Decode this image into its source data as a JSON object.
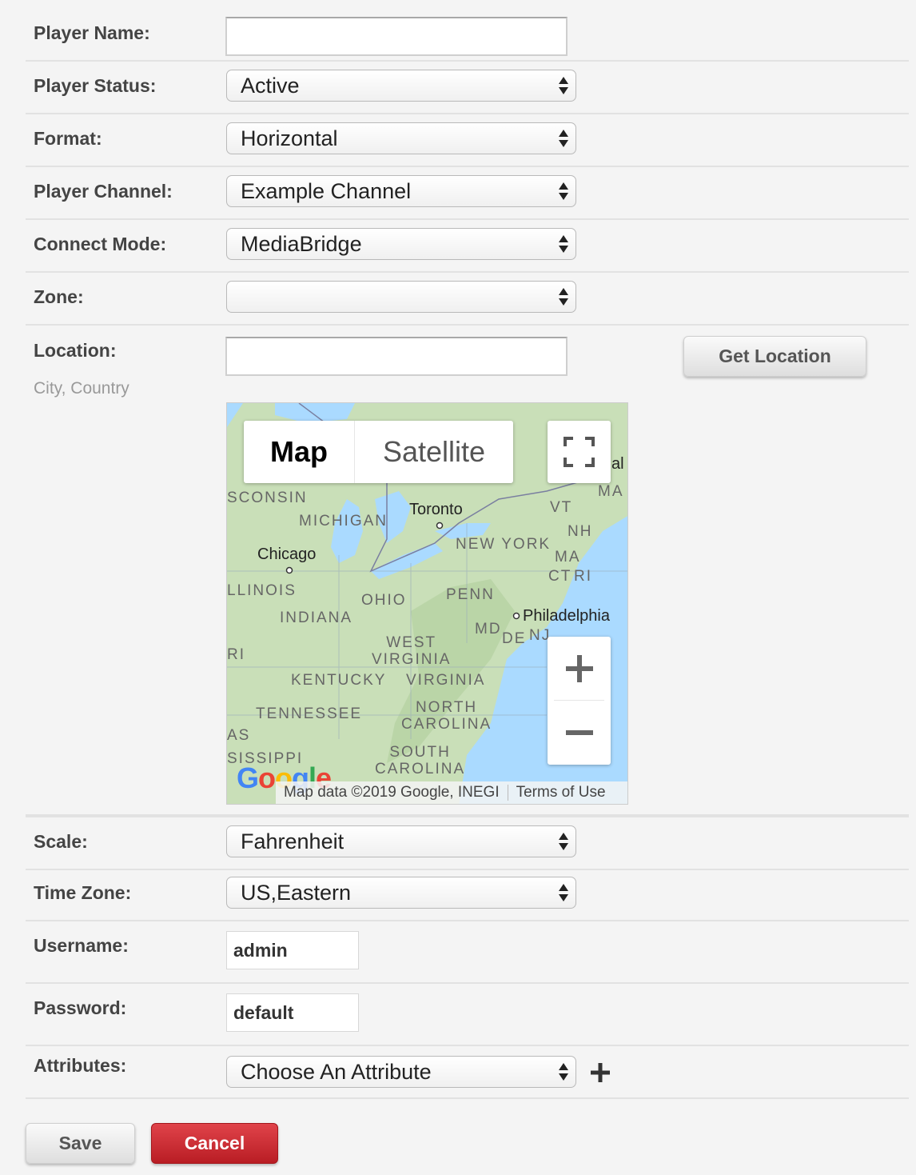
{
  "form": {
    "player_name": {
      "label": "Player Name:",
      "value": ""
    },
    "player_status": {
      "label": "Player Status:",
      "value": "Active"
    },
    "format": {
      "label": "Format:",
      "value": "Horizontal"
    },
    "player_channel": {
      "label": "Player Channel:",
      "value": "Example Channel"
    },
    "connect_mode": {
      "label": "Connect Mode:",
      "value": "MediaBridge"
    },
    "zone": {
      "label": "Zone:",
      "value": ""
    },
    "location": {
      "label": "Location:",
      "hint": "City, Country",
      "value": "",
      "button": "Get Location"
    },
    "scale": {
      "label": "Scale:",
      "value": "Fahrenheit"
    },
    "time_zone": {
      "label": "Time Zone:",
      "value": "US,Eastern"
    },
    "username": {
      "label": "Username:",
      "value": "admin"
    },
    "password": {
      "label": "Password:",
      "value": "default"
    },
    "attributes": {
      "label": "Attributes:",
      "value": "Choose An Attribute"
    }
  },
  "map": {
    "type_map": "Map",
    "type_satellite": "Satellite",
    "places": {
      "toronto": "Toronto",
      "chicago": "Chicago",
      "philadelphia": "Philadelphia",
      "al": "al"
    },
    "states": {
      "wisconsin": "SCONSIN",
      "michigan": "MICHIGAN",
      "new_york": "NEW YORK",
      "illinois": "LLINOIS",
      "ohio": "OHIO",
      "penn": "PENN",
      "indiana": "INDIANA",
      "md": "MD",
      "de": "DE",
      "nj": "NJ",
      "west_virginia": "WEST\nVIRGINIA",
      "ri_left": "RI",
      "kentucky": "KENTUCKY",
      "virginia": "VIRGINIA",
      "tennessee": "TENNESSEE",
      "north_carolina": "NORTH\nCAROLINA",
      "as": "AS",
      "mississippi": "SISSIPPI",
      "south_carolina": "SOUTH\nCAROLINA",
      "vt": "VT",
      "nh": "NH",
      "ma": "MA",
      "ma2": "MA",
      "ct": "CT",
      "ri": "RI"
    },
    "attribution": "Map data ©2019 Google, INEGI",
    "terms": "Terms of Use",
    "logo": "Google"
  },
  "buttons": {
    "save": "Save",
    "cancel": "Cancel"
  },
  "colors": {
    "cancel": "#c8262d",
    "water": "#aadaff",
    "land": "#c9dfb8"
  }
}
